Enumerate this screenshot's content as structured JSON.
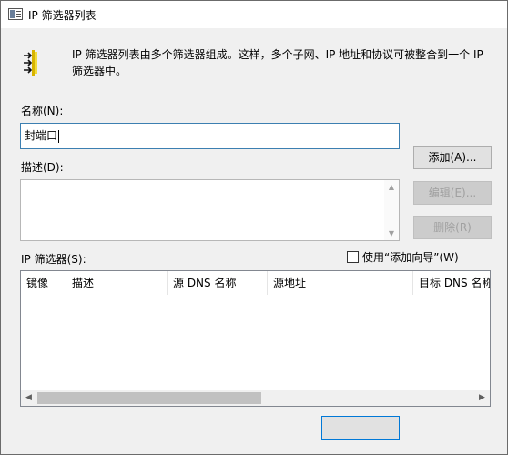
{
  "window": {
    "title": "IP 筛选器列表"
  },
  "description_text": [
    "IP 筛选器列表由多个筛选器组成。这样，多个子网、IP 地址和协议可被整合到一个 IP",
    "筛选器中。"
  ],
  "name": {
    "label": "名称(N):",
    "value": "封端口"
  },
  "description": {
    "label": "描述(D):",
    "value": ""
  },
  "buttons": {
    "add": "添加(A)...",
    "edit": "编辑(E)...",
    "delete": "删除(R)"
  },
  "filters": {
    "label": "IP 筛选器(S):",
    "wizard_label": "使用“添加向导”(W)",
    "wizard_checked": false,
    "columns": [
      "镜像",
      "描述",
      "源 DNS 名称",
      "源地址",
      "目标 DNS 名称"
    ],
    "rows": []
  }
}
